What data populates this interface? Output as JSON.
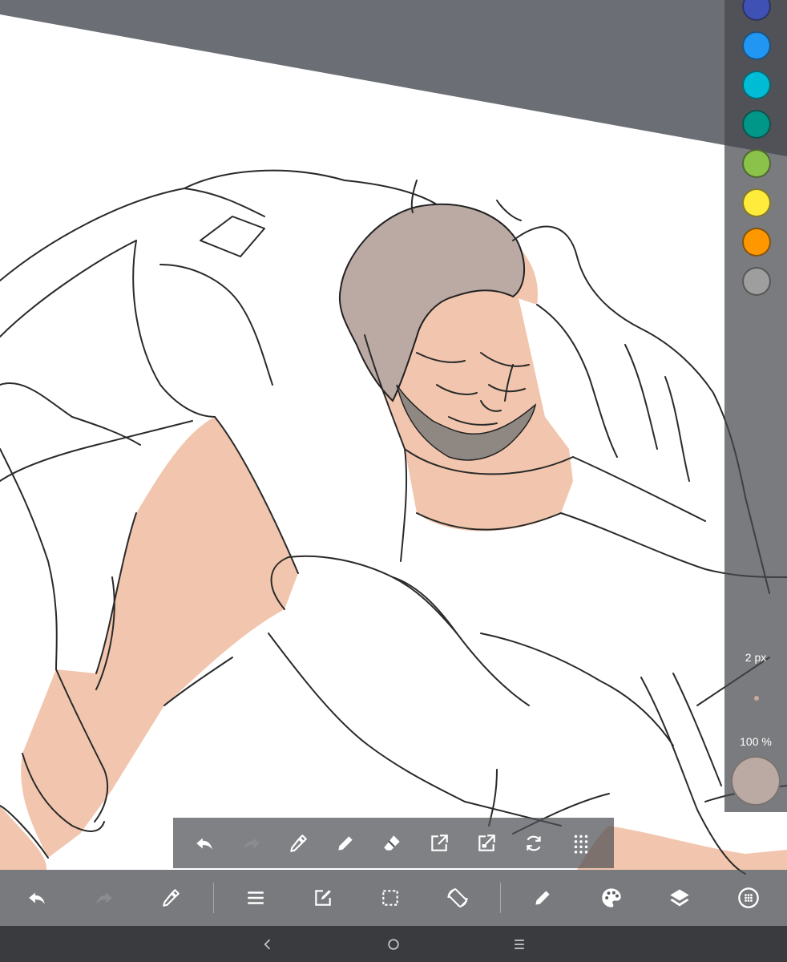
{
  "palette": {
    "colors": [
      "#3f51b5",
      "#2196f3",
      "#00bcd4",
      "#009688",
      "#8bc34a",
      "#ffeb3b",
      "#ff9800",
      "#9e9e9e"
    ],
    "brush_size": "2 px",
    "opacity": "100 %",
    "current_color": "#bbaaa3"
  },
  "quick_toolbar": {
    "tools": [
      "undo-icon",
      "redo-icon",
      "eyedropper-icon",
      "pen-icon",
      "eraser-icon",
      "export-icon",
      "export-layer-icon",
      "rotate-icon",
      "grid-dots-icon"
    ]
  },
  "main_toolbar": {
    "tools": [
      "undo-icon",
      "redo-icon",
      "eyedropper-icon",
      "menu-icon",
      "edit-icon",
      "selection-icon",
      "rotate-screen-icon",
      "pen-icon",
      "palette-icon",
      "layers-icon",
      "grid-circle-icon"
    ]
  },
  "system_nav": {
    "buttons": [
      "back-icon",
      "home-icon",
      "recents-icon"
    ]
  }
}
